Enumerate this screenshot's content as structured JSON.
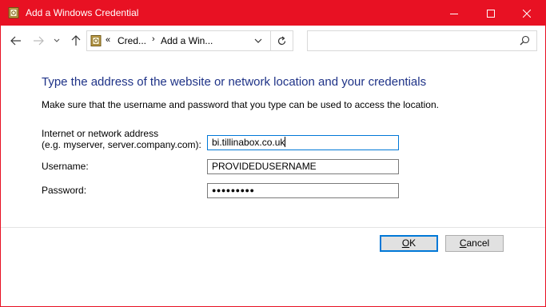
{
  "window": {
    "title": "Add a Windows Credential",
    "accent_color": "#e81123",
    "controls": {
      "minimize": "minimize-icon",
      "maximize": "maximize-icon",
      "close": "close-icon"
    }
  },
  "navigation": {
    "back": "back-arrow-icon",
    "forward": "forward-arrow-icon",
    "recent": "chevron-down-icon",
    "up": "up-arrow-icon",
    "breadcrumb": {
      "overflow": "«",
      "items": [
        "Cred...",
        "Add a Win..."
      ],
      "separator": "›"
    },
    "refresh": "refresh-icon",
    "search": {
      "placeholder": "",
      "icon": "search-icon"
    }
  },
  "form": {
    "heading": "Type the address of the website or network location and your credentials",
    "instruction": "Make sure that the username and password that you type can be used to access the location.",
    "heading_color": "#1e3287",
    "fields": {
      "address": {
        "label_line1": "Internet or network address",
        "label_line2": "(e.g. myserver, server.company.com):",
        "value": "bi.tillinabox.co.uk"
      },
      "username": {
        "label": "Username:",
        "value": "PROVIDEDUSERNAME"
      },
      "password": {
        "label": "Password:",
        "value": "●●●●●●●●●"
      }
    }
  },
  "buttons": {
    "ok": {
      "mnemonic": "O",
      "rest": "K"
    },
    "cancel": {
      "mnemonic": "C",
      "rest": "ancel"
    }
  }
}
